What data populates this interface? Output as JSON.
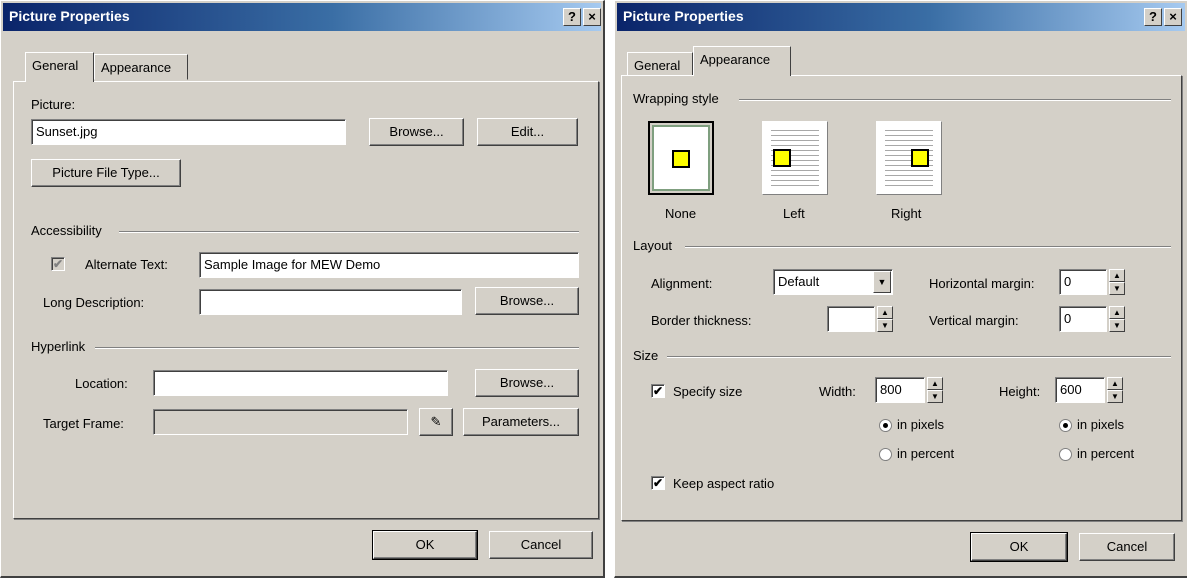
{
  "dialog1": {
    "title": "Picture Properties",
    "help_btn": "?",
    "close_btn": "×",
    "tabs": [
      "General",
      "Appearance"
    ],
    "picture_label": "Picture:",
    "picture_value": "Sunset.jpg",
    "browse_label": "Browse...",
    "edit_label": "Edit...",
    "file_type_label": "Picture File Type...",
    "accessibility_label": "Accessibility",
    "alt_text_label": "Alternate Text:",
    "alt_text_value": "Sample Image for MEW Demo",
    "long_desc_label": "Long Description:",
    "long_desc_value": "",
    "browse2_label": "Browse...",
    "hyperlink_label": "Hyperlink",
    "location_label": "Location:",
    "location_value": "",
    "browse3_label": "Browse...",
    "target_frame_label": "Target Frame:",
    "target_frame_value": "",
    "parameters_label": "Parameters...",
    "ok_label": "OK",
    "cancel_label": "Cancel"
  },
  "dialog2": {
    "title": "Picture Properties",
    "help_btn": "?",
    "close_btn": "×",
    "tabs": [
      "General",
      "Appearance"
    ],
    "wrapping_style_label": "Wrapping style",
    "wrap_none": "None",
    "wrap_left": "Left",
    "wrap_right": "Right",
    "layout_label": "Layout",
    "alignment_label": "Alignment:",
    "alignment_value": "Default",
    "border_label": "Border thickness:",
    "border_value": "",
    "hmargin_label": "Horizontal margin:",
    "hmargin_value": "0",
    "vmargin_label": "Vertical margin:",
    "vmargin_value": "0",
    "size_label": "Size",
    "specify_size_label": "Specify size",
    "width_label": "Width:",
    "width_value": "800",
    "height_label": "Height:",
    "height_value": "600",
    "in_pixels": "in pixels",
    "in_percent_w": "in percent",
    "in_percent_h": "in percent",
    "keep_aspect_label": "Keep aspect ratio",
    "ok_label": "OK",
    "cancel_label": "Cancel"
  },
  "icons": {
    "check": "✔",
    "up": "▲",
    "down": "▼",
    "pencil": "✎"
  }
}
